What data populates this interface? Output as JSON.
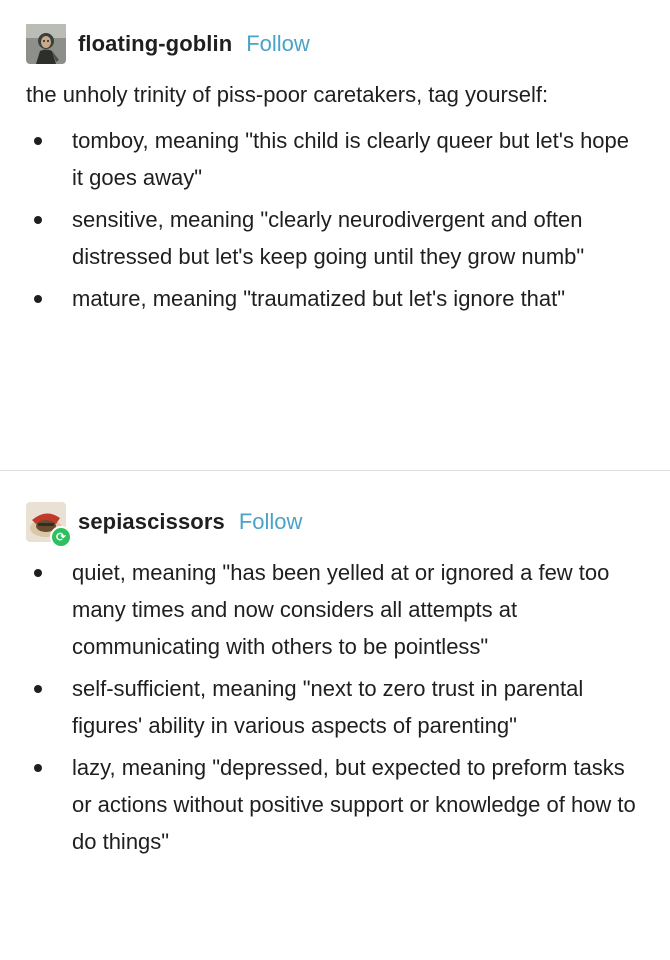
{
  "posts": [
    {
      "username": "floating-goblin",
      "follow_label": "Follow",
      "avatar_icon": "goblin-avatar-icon",
      "intro": "the unholy trinity of piss-poor caretakers, tag yourself:",
      "items": [
        "tomboy, meaning \"this child is clearly queer but let's hope it goes away\"",
        "sensitive, meaning \"clearly neurodivergent and often distressed but let's keep going until they grow numb\"",
        "mature, meaning \"traumatized but let's ignore that\""
      ]
    },
    {
      "username": "sepiascissors",
      "follow_label": "Follow",
      "avatar_icon": "sepia-avatar-icon",
      "reblog_icon": "reblog-icon",
      "items": [
        "quiet, meaning \"has been yelled at or ignored a few too many times and now considers all attempts at communicating with others to be pointless\"",
        "self-sufficient, meaning \"next to zero trust in parental figures' ability in various aspects of parenting\"",
        "lazy, meaning \"depressed, but expected to preform tasks or actions without positive support or knowledge of how to do things\""
      ]
    }
  ],
  "colors": {
    "follow": "#4aa3c7",
    "text": "#1f1f1f",
    "reblog_badge": "#2fbf5f"
  }
}
